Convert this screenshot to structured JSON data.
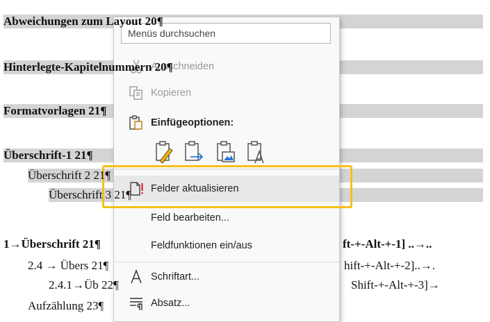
{
  "toc": [
    {
      "text": "Abweichungen zum Layout",
      "page": "20¶",
      "bold": true,
      "shaded": true
    },
    {
      "text": "Hinterlegte-Kapitelnummern",
      "page": "20¶",
      "bold": true,
      "shaded": true
    },
    {
      "text": "Formatvorlagen",
      "page": "21¶",
      "bold": true,
      "shaded": true
    },
    {
      "text": "Überschrift-1",
      "page": "21¶",
      "bold": true,
      "shaded": true
    },
    {
      "text": "Überschrift 2",
      "page": "21¶",
      "bold": false,
      "shaded": true
    },
    {
      "text": "Überschrift 3",
      "page": "21¶",
      "bold": false,
      "shaded": true
    },
    {
      "text": "1→Überschrift",
      "mid": "ft-+-Alt-+-1] ..→..",
      "page": "21¶",
      "bold": true,
      "shaded": false
    },
    {
      "text": "2.4 → Übers",
      "mid": "hift-+-Alt-+-2]..→.",
      "page": "21¶",
      "bold": false,
      "shaded": false
    },
    {
      "text": "2.4.1→Üb",
      "mid": "Shift-+-Alt-+-3]→",
      "page": "22¶",
      "bold": false,
      "shaded": false
    },
    {
      "text": "Aufzählung",
      "page": "23¶",
      "bold": false,
      "shaded": false
    }
  ],
  "menu": {
    "search_placeholder": "Menüs durchsuchen",
    "cut": "Ausschneiden",
    "copy": "Kopieren",
    "paste_options": "Einfügeoptionen:",
    "update_fields": "Felder aktualisieren",
    "edit_field": "Feld bearbeiten...",
    "toggle_field_codes": "Feldfunktionen ein/aus",
    "font": "Schriftart...",
    "paragraph": "Absatz..."
  },
  "colors": {
    "highlight_border": "#f5c11a",
    "update_icon_mark": "#e81123",
    "paste_icon_accent": "#2b79d3"
  }
}
